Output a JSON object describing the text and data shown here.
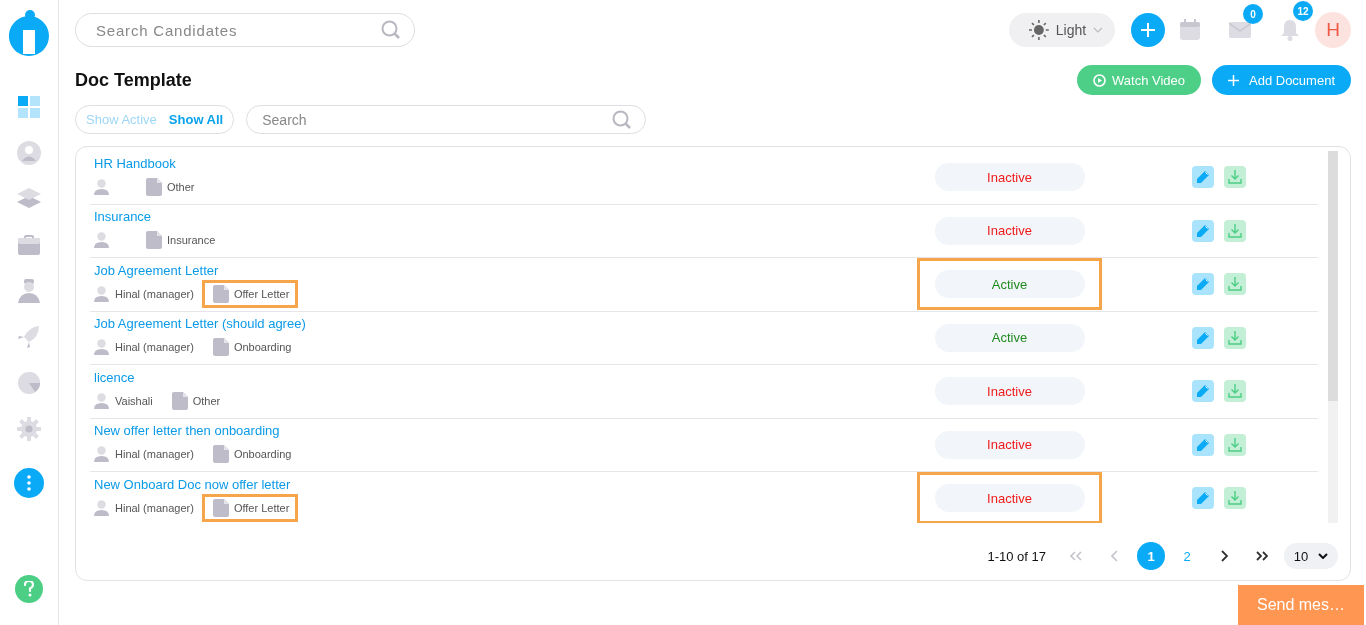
{
  "sidebar": {
    "items": [
      {
        "selected": true
      },
      {
        "selected": false
      },
      {
        "selected": false
      },
      {
        "selected": false
      },
      {
        "selected": false
      },
      {
        "selected": false
      },
      {
        "selected": false
      },
      {
        "selected": false
      }
    ]
  },
  "top_bar": {
    "search": {
      "placeholder": "Search Candidates"
    },
    "theme": "Light",
    "mail_badge": "0",
    "notification_badge": "12",
    "avatar": "H"
  },
  "page_title": "Doc Template",
  "actions": [
    "Watch Video",
    "Add Document"
  ],
  "filters": [
    {
      "label": "Show Active",
      "selected": false
    },
    {
      "label": "Show All",
      "selected": true
    }
  ],
  "search": {
    "placeholder": "Search"
  },
  "rows": [
    {
      "name": "HR Handbook",
      "category": "Other",
      "status": "Inactive",
      "active": false,
      "category_highlighted": false,
      "status_highlighted": false
    },
    {
      "name": "Insurance",
      "category": "Insurance",
      "status": "Inactive",
      "active": false,
      "category_highlighted": false,
      "status_highlighted": false
    },
    {
      "name": "Job Agreement Letter",
      "owner": "Hinal (manager)",
      "category": "Offer Letter",
      "status": "Active",
      "active": true,
      "category_highlighted": true,
      "status_highlighted": true
    },
    {
      "name": "Job Agreement Letter (should agree)",
      "owner": "Hinal (manager)",
      "category": "Onboarding",
      "status": "Active",
      "active": true,
      "category_highlighted": false,
      "status_highlighted": false
    },
    {
      "name": "licence",
      "owner": "Vaishali",
      "category": "Other",
      "status": "Inactive",
      "active": false,
      "category_highlighted": false,
      "status_highlighted": false
    },
    {
      "name": "New offer letter then onboarding",
      "owner": "Hinal (manager)",
      "category": "Onboarding",
      "status": "Inactive",
      "active": false,
      "category_highlighted": false,
      "status_highlighted": false
    },
    {
      "name": "New Onboard Doc now offer letter",
      "owner": "Hinal (manager)",
      "category": "Offer Letter",
      "status": "Inactive",
      "active": false,
      "category_highlighted": true,
      "status_highlighted": true
    }
  ],
  "pagination": {
    "range": "1-10 of 17",
    "first_disabled": true,
    "prev_disabled": true,
    "pages": [
      {
        "label": "1",
        "selected": true
      },
      {
        "label": "2",
        "selected": false
      }
    ],
    "next_disabled": false,
    "last_disabled": false,
    "page_size": "10"
  },
  "chat_button": "Send mes…"
}
